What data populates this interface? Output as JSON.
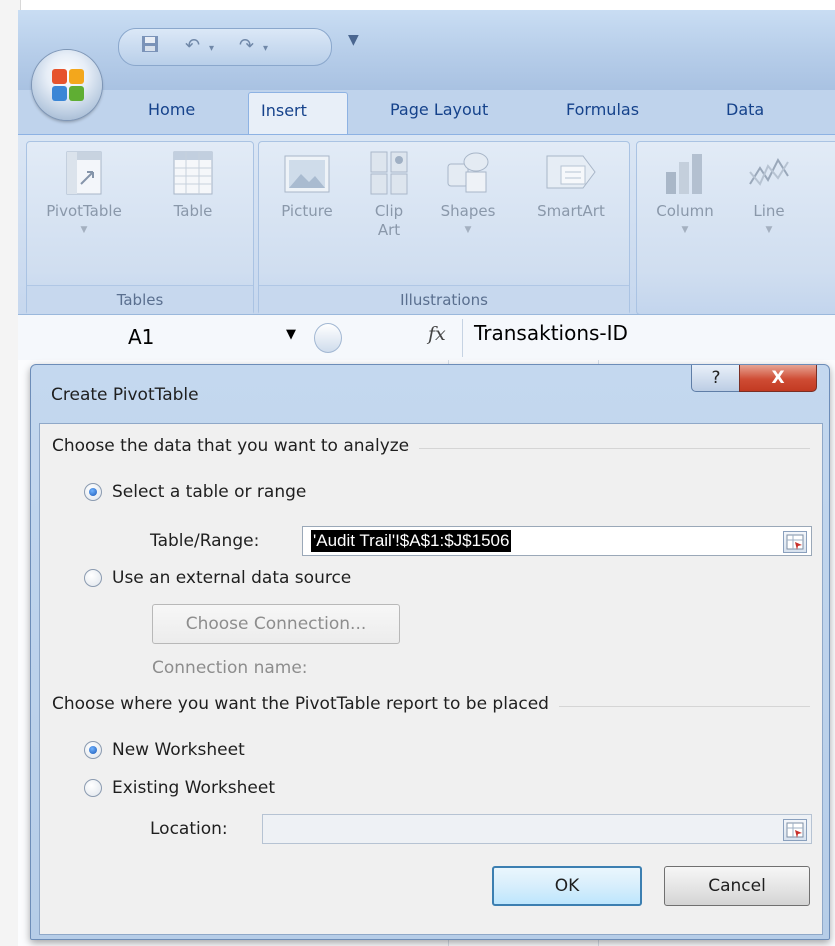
{
  "ribbon": {
    "tabs": [
      "Home",
      "Insert",
      "Page Layout",
      "Formulas",
      "Data"
    ],
    "active_tab": "Insert",
    "groups": {
      "tables": {
        "label": "Tables",
        "buttons": [
          {
            "label": "PivotTable",
            "icon": "pivottable-icon"
          },
          {
            "label": "Table",
            "icon": "table-icon"
          }
        ]
      },
      "illustrations": {
        "label": "Illustrations",
        "buttons": [
          {
            "label": "Picture",
            "icon": "picture-icon"
          },
          {
            "label": "Clip",
            "label2": "Art",
            "icon": "clip-art-icon"
          },
          {
            "label": "Shapes",
            "icon": "shapes-icon"
          },
          {
            "label": "SmartArt",
            "icon": "smartart-icon"
          }
        ]
      },
      "charts": {
        "buttons": [
          {
            "label": "Column",
            "icon": "column-chart-icon"
          },
          {
            "label": "Line",
            "icon": "line-chart-icon"
          }
        ]
      }
    }
  },
  "formula_bar": {
    "name_box": "A1",
    "fx": "fx",
    "formula": "Transaktions-ID"
  },
  "dialog": {
    "title": "Create PivotTable",
    "help_label": "?",
    "close_label": "X",
    "section1": "Choose the data that you want to analyze",
    "option_table": "Select a table or range",
    "table_range_label": "Table/Range:",
    "table_range_value": "'Audit Trail'!$A$1:$J$1506",
    "option_external": "Use an external data source",
    "choose_connection_label": "Choose Connection...",
    "connection_name_label": "Connection name:",
    "section2": "Choose where you want the PivotTable report to be placed",
    "option_new": "New Worksheet",
    "option_existing": "Existing Worksheet",
    "location_label": "Location:",
    "location_value": "",
    "ok_label": "OK",
    "cancel_label": "Cancel",
    "selected_source": "Select a table or range",
    "selected_placement": "New Worksheet"
  }
}
